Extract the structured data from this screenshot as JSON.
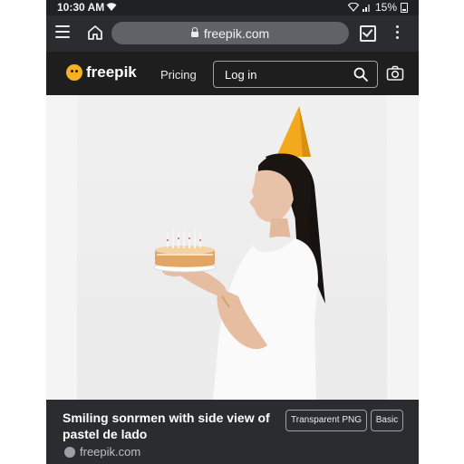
{
  "status_bar": {
    "time": "10:30 AM",
    "battery": "15%"
  },
  "browser": {
    "url": "freepik.com"
  },
  "site_header": {
    "logo_text": "freepik",
    "pricing_label": "Pricing",
    "login_label": "Log in"
  },
  "image_card": {
    "title": "Smiling sonrmen with side view of pastel de lado",
    "tags": [
      "Transparent PNG",
      "Basic"
    ],
    "source": "freepik.com"
  },
  "colors": {
    "page_background": "#202124",
    "header_background": "#1e1e1e",
    "brand_yellow": "#f5b324",
    "party_hat": "#f2a91e"
  }
}
